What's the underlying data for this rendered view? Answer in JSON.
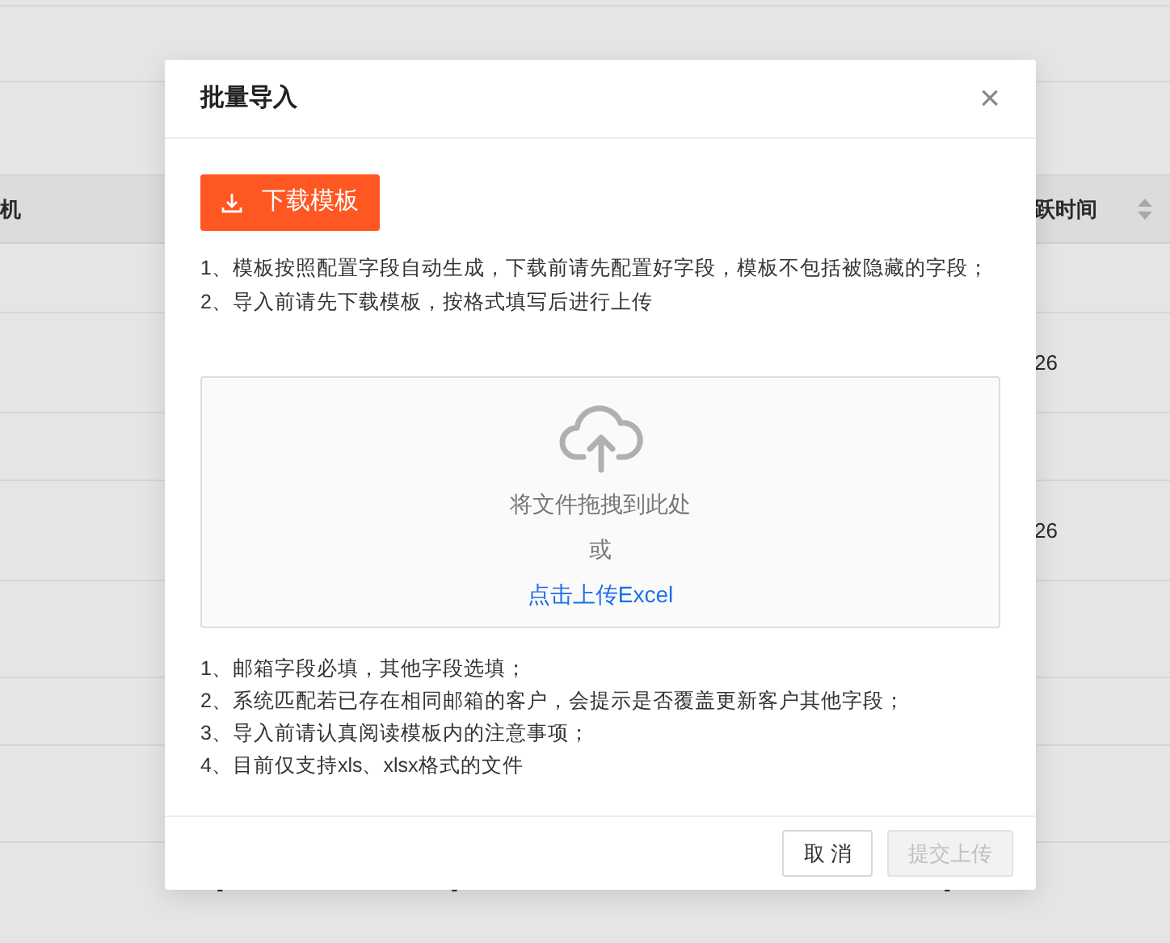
{
  "background_table": {
    "columns": [
      {
        "label": "机",
        "sortable": false
      },
      {},
      {},
      {},
      {
        "label": "跃时间",
        "sortable": true
      }
    ],
    "rows": [
      {
        "cells": [
          "",
          "",
          "",
          "",
          "26"
        ]
      },
      {
        "cells": [
          "",
          "",
          "",
          "",
          "26"
        ]
      },
      {
        "cells": [
          "",
          "-",
          "-",
          "-",
          ""
        ]
      }
    ]
  },
  "dialog": {
    "title": "批量导入",
    "close": "×",
    "download_button": "下载模板",
    "notes_top": [
      "1、模板按照配置字段自动生成，下载前请先配置好字段，模板不包括被隐藏的字段；",
      "2、导入前请先下载模板，按格式填写后进行上传"
    ],
    "dropzone": {
      "hint": "将文件拖拽到此处",
      "or": "或",
      "link": "点击上传Excel"
    },
    "notes_bottom": [
      "1、邮箱字段必填，其他字段选填；",
      "2、系统匹配若已存在相同邮箱的客户，会提示是否覆盖更新客户其他字段；",
      "3、导入前请认真阅读模板内的注意事项；",
      "4、目前仅支持xls、xlsx格式的文件"
    ],
    "buttons": [
      {
        "label": "取 消",
        "disabled": false
      },
      {
        "label": "提交上传",
        "disabled": true
      }
    ]
  }
}
